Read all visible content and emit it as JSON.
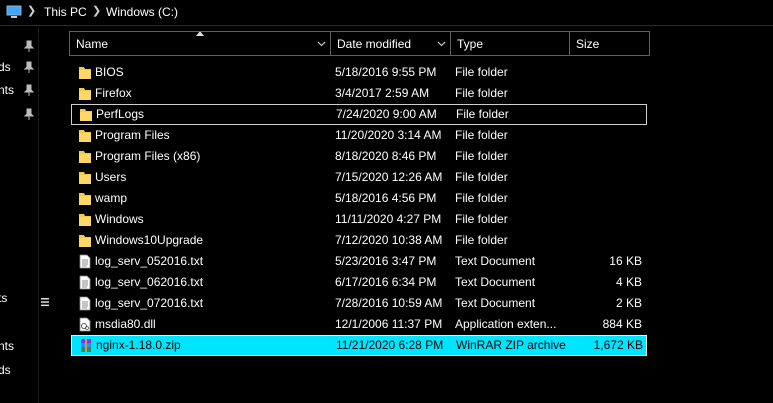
{
  "address": {
    "segments": [
      "This PC",
      "Windows (C:)"
    ]
  },
  "nav": {
    "items": [
      "ds",
      "nts",
      "",
      "",
      "ts",
      "nts",
      "ds"
    ]
  },
  "columns": {
    "name": "Name",
    "date": "Date modified",
    "type": "Type",
    "size": "Size"
  },
  "files": [
    {
      "name": "BIOS",
      "date": "5/18/2016 9:55 PM",
      "type": "File folder",
      "size": "",
      "icon": "folder-icon"
    },
    {
      "name": "Firefox",
      "date": "3/4/2017 2:59 AM",
      "type": "File folder",
      "size": "",
      "icon": "folder-icon"
    },
    {
      "name": "PerfLogs",
      "date": "7/24/2020 9:00 AM",
      "type": "File folder",
      "size": "",
      "icon": "folder-icon"
    },
    {
      "name": "Program Files",
      "date": "11/20/2020 3:14 AM",
      "type": "File folder",
      "size": "",
      "icon": "folder-icon"
    },
    {
      "name": "Program Files (x86)",
      "date": "8/18/2020 8:46 PM",
      "type": "File folder",
      "size": "",
      "icon": "folder-icon"
    },
    {
      "name": "Users",
      "date": "7/15/2020 12:26 AM",
      "type": "File folder",
      "size": "",
      "icon": "folder-icon"
    },
    {
      "name": "wamp",
      "date": "5/18/2016 4:56 PM",
      "type": "File folder",
      "size": "",
      "icon": "folder-icon"
    },
    {
      "name": "Windows",
      "date": "11/11/2020 4:27 PM",
      "type": "File folder",
      "size": "",
      "icon": "folder-icon"
    },
    {
      "name": "Windows10Upgrade",
      "date": "7/12/2020 10:38 AM",
      "type": "File folder",
      "size": "",
      "icon": "folder-icon"
    },
    {
      "name": "log_serv_052016.txt",
      "date": "5/23/2016 3:47 PM",
      "type": "Text Document",
      "size": "16 KB",
      "icon": "text-file-icon"
    },
    {
      "name": "log_serv_062016.txt",
      "date": "6/17/2016 6:34 PM",
      "type": "Text Document",
      "size": "4 KB",
      "icon": "text-file-icon"
    },
    {
      "name": "log_serv_072016.txt",
      "date": "7/28/2016 10:59 AM",
      "type": "Text Document",
      "size": "2 KB",
      "icon": "text-file-icon"
    },
    {
      "name": "msdia80.dll",
      "date": "12/1/2006 11:37 PM",
      "type": "Application exten...",
      "size": "884 KB",
      "icon": "dll-file-icon"
    },
    {
      "name": "nginx-1.18.0.zip",
      "date": "11/21/2020 6:28 PM",
      "type": "WinRAR ZIP archive",
      "size": "1,672 KB",
      "icon": "winrar-archive-icon"
    }
  ],
  "colors": {
    "background": "#000000",
    "selection": "#00e5ff",
    "folder": "#f5c84c"
  }
}
